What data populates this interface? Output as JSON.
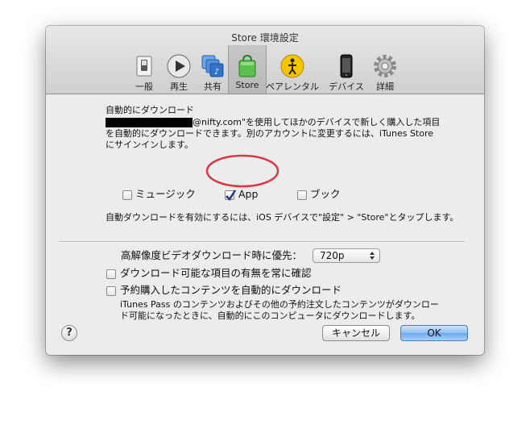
{
  "window": {
    "title": "Store 環境設定"
  },
  "toolbar": {
    "items": [
      {
        "label": "一般",
        "icon": "switch-icon"
      },
      {
        "label": "再生",
        "icon": "play-icon"
      },
      {
        "label": "共有",
        "icon": "sharing-icon"
      },
      {
        "label": "Store",
        "icon": "store-bag-icon",
        "selected": true
      },
      {
        "label": "ペアレンタル",
        "icon": "parental-icon"
      },
      {
        "label": "デバイス",
        "icon": "iphone-icon"
      },
      {
        "label": "詳細",
        "icon": "gear-icon"
      }
    ]
  },
  "auto_download": {
    "heading": "自動的にダウンロード",
    "desc_line1_suffix": "@nifty.com\"を使用してほかのデバイスで新しく購入した項目",
    "desc_line2": "を自動的にダウンロードできます。別のアカウントに変更するには、iTunes Store",
    "desc_line3": "にサインインします。",
    "options": [
      {
        "label": "ミュージック",
        "checked": false
      },
      {
        "label": "App",
        "checked": true
      },
      {
        "label": "ブック",
        "checked": false
      }
    ],
    "ios_note": "自動ダウンロードを有効にするには、iOS デバイスで\"設定\" > \"Store\"とタップします。"
  },
  "hd": {
    "label": "高解像度ビデオダウンロード時に優先：",
    "value": "720p"
  },
  "checks": {
    "always_check": {
      "label": "ダウンロード可能な項目の有無を常に確認",
      "checked": false
    },
    "preorder": {
      "label": "予約購入したコンテンツを自動的にダウンロード",
      "checked": false
    },
    "preorder_desc1": "iTunes Pass のコンテンツおよびその他の予約注文したコンテンツがダウンロー",
    "preorder_desc2": "ド可能になったときに、自動的にこのコンピュータにダウンロードします。"
  },
  "buttons": {
    "help": "?",
    "cancel": "キャンセル",
    "ok": "OK"
  },
  "colors": {
    "annotation": "#d9384a",
    "default_button": "#6aa8ee"
  }
}
